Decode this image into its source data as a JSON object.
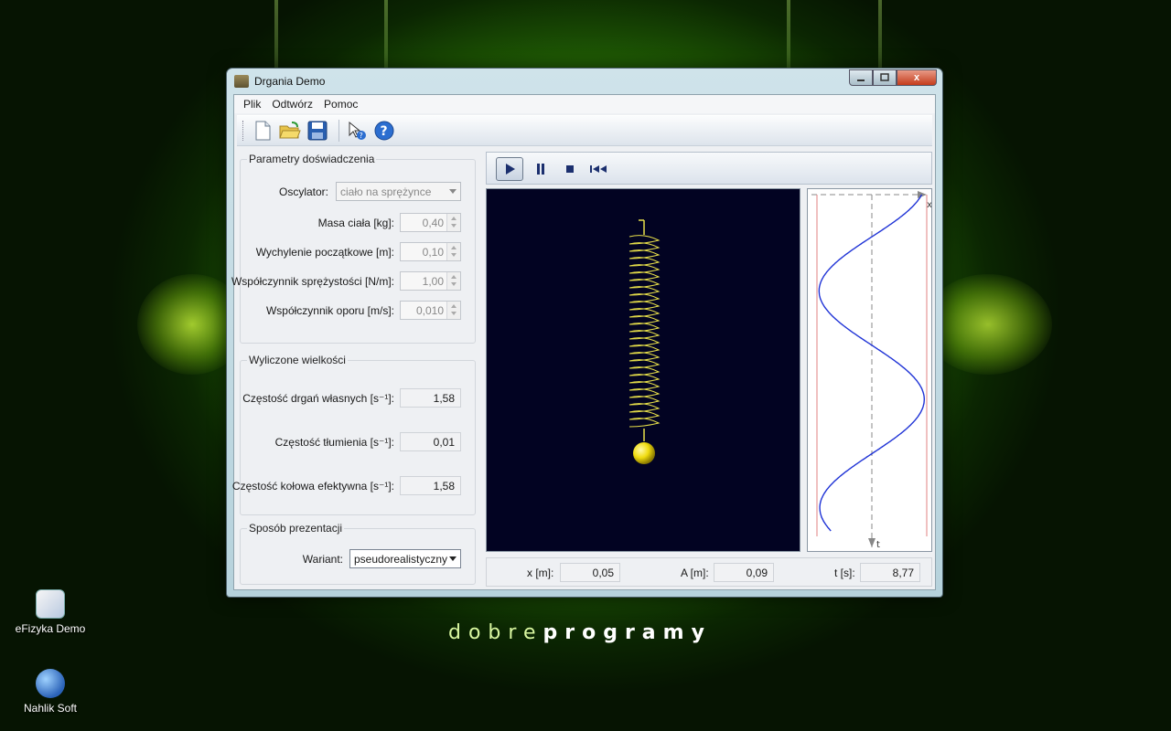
{
  "window": {
    "title": "Drgania Demo",
    "close_label": "x"
  },
  "menu": {
    "items": [
      "Plik",
      "Odtwórz",
      "Pomoc"
    ]
  },
  "toolbar": {
    "icons": [
      "new-document-icon",
      "open-folder-icon",
      "save-icon",
      "context-help-icon",
      "help-icon"
    ]
  },
  "params": {
    "title": "Parametry doświadczenia",
    "oscillator_label": "Oscylator:",
    "oscillator_value": "ciało na sprężynce",
    "mass_label": "Masa ciała [kg]:",
    "mass_value": "0,40",
    "displacement_label": "Wychylenie początkowe [m]:",
    "displacement_value": "0,10",
    "stiffness_label": "Współczynnik sprężystości [N/m]:",
    "stiffness_value": "1,00",
    "drag_label": "Współczynnik oporu [m/s]:",
    "drag_value": "0,010"
  },
  "computed": {
    "title": "Wyliczone wielkości",
    "natural_label": "Częstość drgań własnych [s⁻¹]:",
    "natural_value": "1,58",
    "damping_label": "Częstość tłumienia [s⁻¹]:",
    "damping_value": "0,01",
    "effective_label": "Częstość kołowa efektywna [s⁻¹]:",
    "effective_value": "1,58"
  },
  "presentation": {
    "title": "Sposób prezentacji",
    "variant_label": "Wariant:",
    "variant_value": "pseudorealistyczny"
  },
  "graph": {
    "x_axis_label": "x",
    "t_axis_label": "t"
  },
  "status": {
    "x_label": "x [m]:",
    "x_value": "0,05",
    "a_label": "A [m]:",
    "a_value": "0,09",
    "t_label": "t [s]:",
    "t_value": "8,77"
  },
  "desktop": {
    "icon1": "eFizyka Demo",
    "icon2": "Nahlik Soft"
  },
  "brand": {
    "light": "dobre",
    "bold": "programy"
  },
  "colors": {
    "sim_background": "#020322",
    "spring": "#e8e04a",
    "curve": "#1f33d6",
    "accent_green": "#7fc812"
  }
}
